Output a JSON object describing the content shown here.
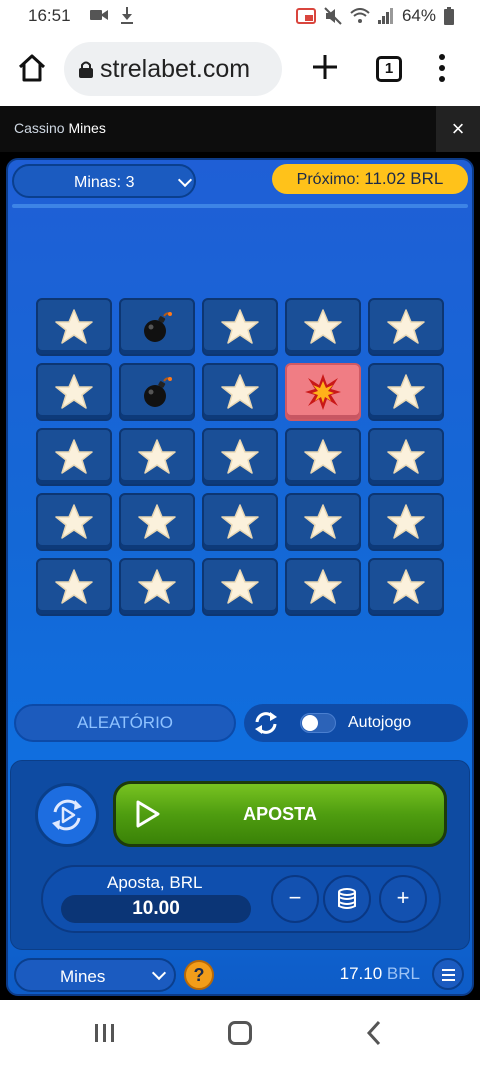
{
  "status_bar": {
    "time": "16:51",
    "battery": "64%"
  },
  "browser": {
    "url": "strelabet.com",
    "tab_count": "1"
  },
  "casino_header": {
    "section": "Cassino",
    "game": "Mines",
    "close": "×"
  },
  "game": {
    "mines_selector": "Minas: 3",
    "next_payout": {
      "label": "Próximo:",
      "value": "11.02 BRL"
    },
    "grid": [
      [
        "star",
        "bomb",
        "star",
        "star",
        "star"
      ],
      [
        "star",
        "bomb",
        "star",
        "explosion",
        "star"
      ],
      [
        "star",
        "star",
        "star",
        "star",
        "star"
      ],
      [
        "star",
        "star",
        "star",
        "star",
        "star"
      ],
      [
        "star",
        "star",
        "star",
        "star",
        "star"
      ]
    ],
    "random_button": "ALEATÓRIO",
    "autoplay_label": "Autojogo",
    "autoplay_on": false,
    "bet_button": "APOSTA",
    "stake": {
      "label": "Aposta, BRL",
      "value": "10.00",
      "minus": "−",
      "plus": "+"
    },
    "game_selector": "Mines",
    "help": "?",
    "balance": {
      "amount": "17.10",
      "currency": "BRL"
    }
  },
  "colors": {
    "accent_yellow": "#ffc21a",
    "bet_green": "#4f9d10",
    "hit_tile": "#f07d84",
    "game_blue": "#1468d6"
  }
}
